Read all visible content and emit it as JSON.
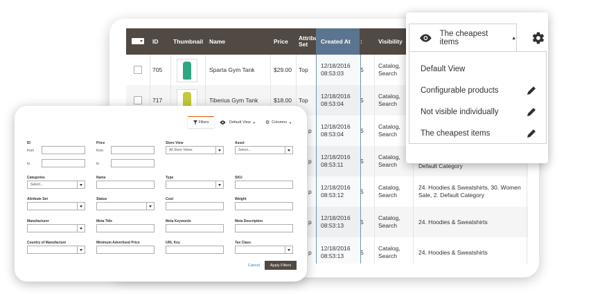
{
  "grid": {
    "headers": {
      "id": "ID",
      "thumbnail": "Thumbnail",
      "name": "Name",
      "price": "Price",
      "attribute_set": "Attribu Set",
      "created_at": "Created At",
      "trunc": ":",
      "visibility": "Visibility"
    },
    "rows": [
      {
        "id": "705",
        "name": "Sparta Gym Tank",
        "price": "$29.00",
        "attr": "Top",
        "created": "12/18/2016 08:53:03",
        "vis": "Catalog, Search",
        "cat": ""
      },
      {
        "id": "717",
        "name": "Tiberius Gym Tank",
        "price": "$18.00",
        "attr": "Top",
        "created": "12/18/2016 08:53:04",
        "vis": "Catalog, Search",
        "cat": ""
      },
      {
        "id": "",
        "name": "",
        "price": "",
        "attr": "p",
        "created": "12/18/2016 08:53:04",
        "vis": "Catalog, Search",
        "cat": ""
      },
      {
        "id": "",
        "name": "",
        "price": "",
        "attr": "p",
        "created": "12/18/2016 08:53:11",
        "vis": "Catalog, Search",
        "cat": "Default Category"
      },
      {
        "id": "",
        "name": "",
        "price": "",
        "attr": "p",
        "created": "12/18/2016 08:53:12",
        "vis": "Catalog, Search",
        "cat": "24. Hoodies & Sweatshirts, 30. Women Sale, 2. Default Category"
      },
      {
        "id": "",
        "name": "",
        "price": "",
        "attr": "p",
        "created": "12/18/2016 08:53:13",
        "vis": "Catalog, Search",
        "cat": "24. Hoodies & Sweatshirts"
      },
      {
        "id": "",
        "name": "",
        "price": "",
        "attr": "p",
        "created": "12/18/2016 08:53:13",
        "vis": "Catalog, Search",
        "cat": "24. Hoodies & Sweatshirts"
      }
    ],
    "trunc_digit": "5"
  },
  "views": {
    "current": "The cheapest items",
    "items": [
      "Default View",
      "Configurable products",
      "Not visible individually",
      "The cheapest items"
    ]
  },
  "filters": {
    "toolbar": {
      "filters": "Filters",
      "default_view": "Default View",
      "columns": "Columns"
    },
    "id": {
      "label": "ID",
      "from": "from",
      "to": "to"
    },
    "price": {
      "label": "Price",
      "from": "from",
      "to": "to"
    },
    "store_view": {
      "label": "Store View",
      "value": "All Store Views"
    },
    "asset": {
      "label": "Asset",
      "value": "Select..."
    },
    "categories": {
      "label": "Categories",
      "value": "Select..."
    },
    "name": {
      "label": "Name"
    },
    "type": {
      "label": "Type"
    },
    "sku": {
      "label": "SKU"
    },
    "attribute_set": {
      "label": "Attribute Set"
    },
    "status": {
      "label": "Status"
    },
    "cost": {
      "label": "Cost"
    },
    "weight": {
      "label": "Weight"
    },
    "manufacturer": {
      "label": "Manufacturer"
    },
    "meta_title": {
      "label": "Meta Title"
    },
    "meta_keywords": {
      "label": "Meta Keywords"
    },
    "meta_description": {
      "label": "Meta Description"
    },
    "country": {
      "label": "Country of Manufacture"
    },
    "map": {
      "label": "Minimum Advertised Price"
    },
    "url_key": {
      "label": "URL Key"
    },
    "tax_class": {
      "label": "Tax Class"
    },
    "cancel": "Cancel",
    "apply": "Apply Filters"
  },
  "colors": {
    "header": "#514943",
    "accent": "#eb5202",
    "link": "#1979c3",
    "highlight": "#5b7590"
  }
}
